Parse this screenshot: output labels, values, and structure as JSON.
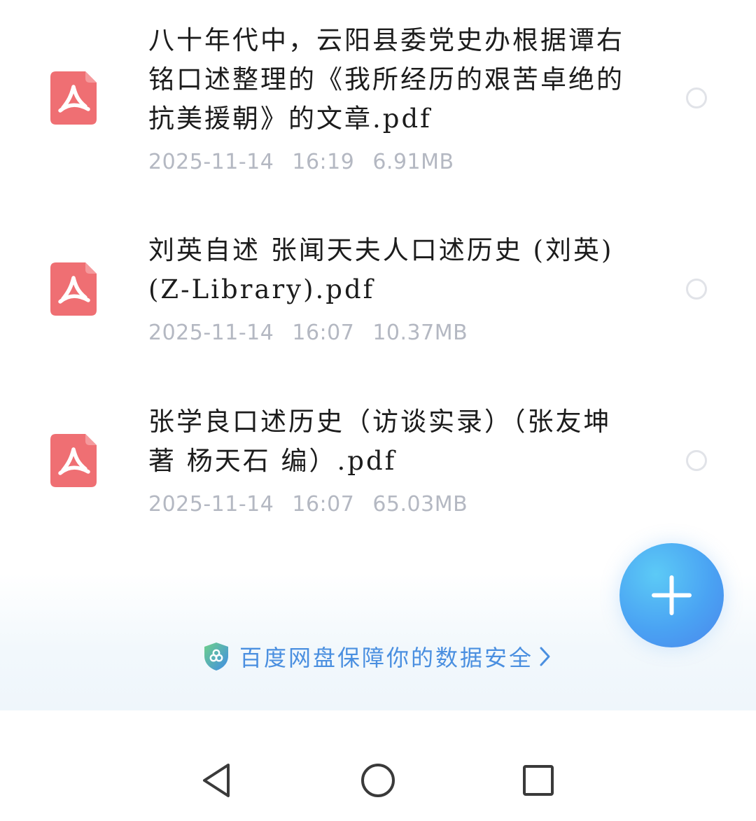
{
  "files": [
    {
      "name": "八十年代中，云阳县委党史办根据谭右铭口述整理的《我所经历的艰苦卓绝的抗美援朝》的文章.pdf",
      "date": "2025-11-14",
      "time": "16:19",
      "size": "6.91MB",
      "icon": "pdf-icon",
      "selected": false
    },
    {
      "name": "刘英自述 张闻天夫人口述历史 (刘英) (Z-Library).pdf",
      "date": "2025-11-14",
      "time": "16:07",
      "size": "10.37MB",
      "icon": "pdf-icon",
      "selected": false
    },
    {
      "name": "张学良口述历史（访谈实录）（张友坤 著 杨天石 编）.pdf",
      "date": "2025-11-14",
      "time": "16:07",
      "size": "65.03MB",
      "icon": "pdf-icon",
      "selected": false
    }
  ],
  "security_banner": {
    "text": "百度网盘保障你的数据安全",
    "icon": "shield-icon",
    "color": "#4a8fe0"
  },
  "fab": {
    "icon": "plus-icon"
  },
  "nav": {
    "back_icon": "triangle-back-icon",
    "home_icon": "circle-home-icon",
    "recents_icon": "square-recents-icon"
  },
  "colors": {
    "pdf_icon": "#ef6f73",
    "fab": "#4aa3f3",
    "meta_text": "#b4b8c2"
  }
}
